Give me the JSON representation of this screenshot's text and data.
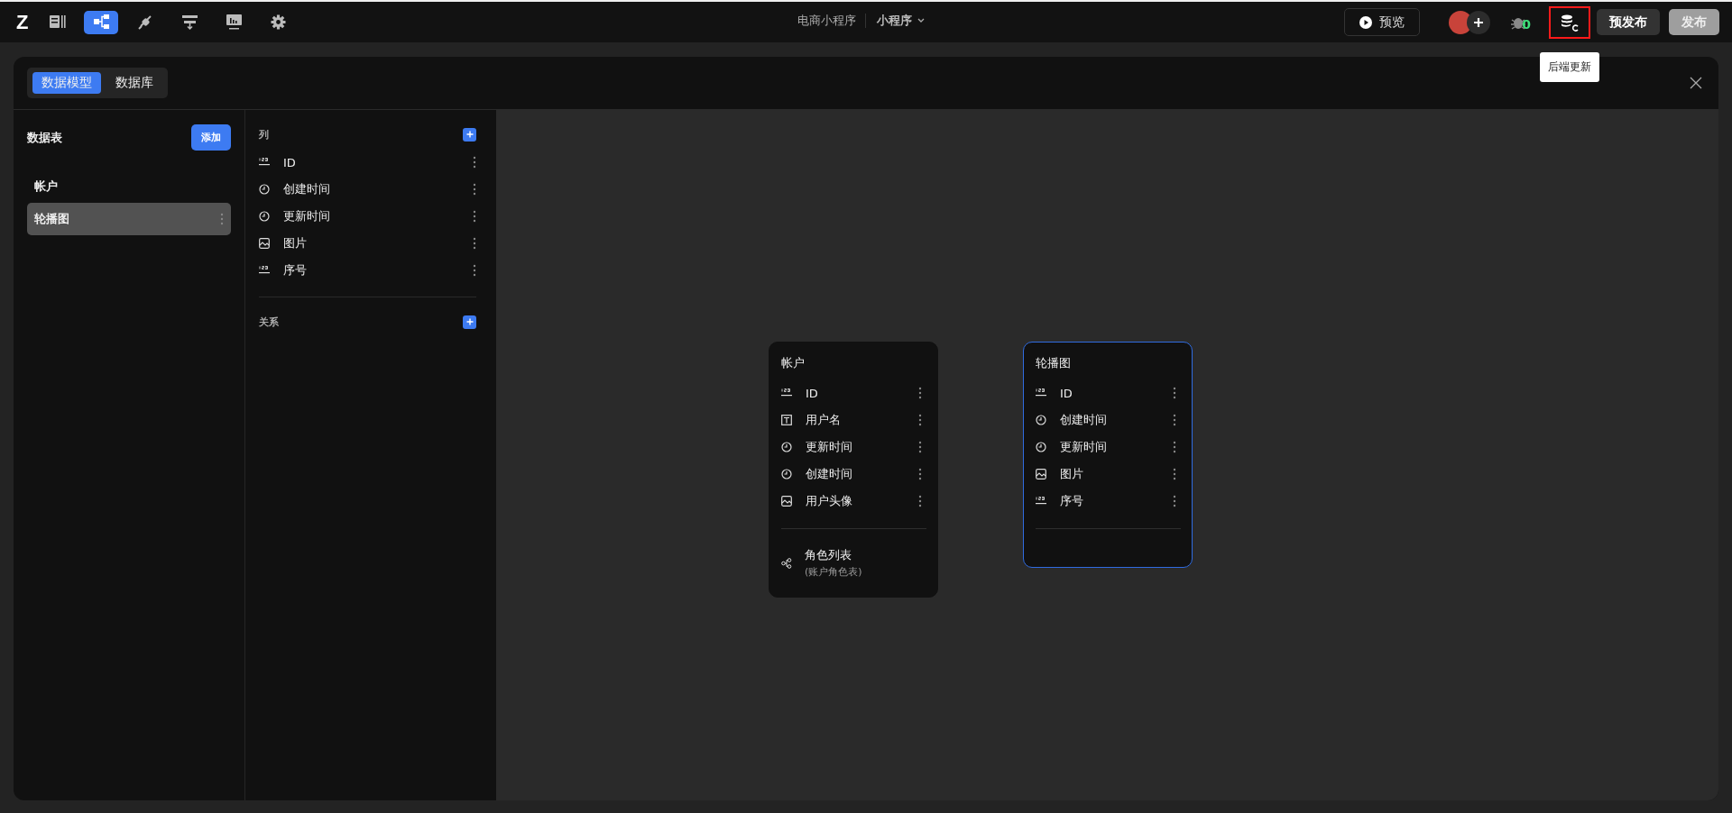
{
  "topbar": {
    "logo": "Z",
    "nav": [
      {
        "kind": "pages",
        "selected": false
      },
      {
        "kind": "model",
        "selected": true
      },
      {
        "kind": "plugin",
        "selected": false
      },
      {
        "kind": "workflow",
        "selected": false
      },
      {
        "kind": "dashboard",
        "selected": false
      },
      {
        "kind": "settings",
        "selected": false
      }
    ],
    "project": "电商小程序",
    "platform": "小程序",
    "preview": "预览",
    "bug_count": "0",
    "backend_update": {
      "tooltip": "后端更新",
      "highlighted": true
    },
    "prepublish": "预发布",
    "publish": {
      "label": "发布",
      "disabled": true
    }
  },
  "tabs": [
    {
      "label": "数据模型",
      "selected": true
    },
    {
      "label": "数据库",
      "selected": false
    }
  ],
  "tables": {
    "title": "数据表",
    "add": "添加",
    "items": [
      {
        "name": "帐户",
        "selected": false
      },
      {
        "name": "轮播图",
        "selected": true
      }
    ]
  },
  "columns_panel": {
    "title": "列",
    "fields": [
      {
        "kind": "number",
        "name": "ID"
      },
      {
        "kind": "time",
        "name": "创建时间"
      },
      {
        "kind": "time",
        "name": "更新时间"
      },
      {
        "kind": "image",
        "name": "图片"
      },
      {
        "kind": "number",
        "name": "序号"
      }
    ],
    "relations_title": "关系"
  },
  "diagram": [
    {
      "title": "帐户",
      "selected": false,
      "fields": [
        {
          "kind": "number",
          "name": "ID"
        },
        {
          "kind": "text",
          "name": "用户名"
        },
        {
          "kind": "time",
          "name": "更新时间"
        },
        {
          "kind": "time",
          "name": "创建时间"
        },
        {
          "kind": "image",
          "name": "用户头像"
        }
      ],
      "relations": [
        {
          "name": "角色列表",
          "table": "(账户角色表)"
        }
      ]
    },
    {
      "title": "轮播图",
      "selected": true,
      "fields": [
        {
          "kind": "number",
          "name": "ID"
        },
        {
          "kind": "time",
          "name": "创建时间"
        },
        {
          "kind": "time",
          "name": "更新时间"
        },
        {
          "kind": "image",
          "name": "图片"
        },
        {
          "kind": "number",
          "name": "序号"
        }
      ]
    }
  ]
}
